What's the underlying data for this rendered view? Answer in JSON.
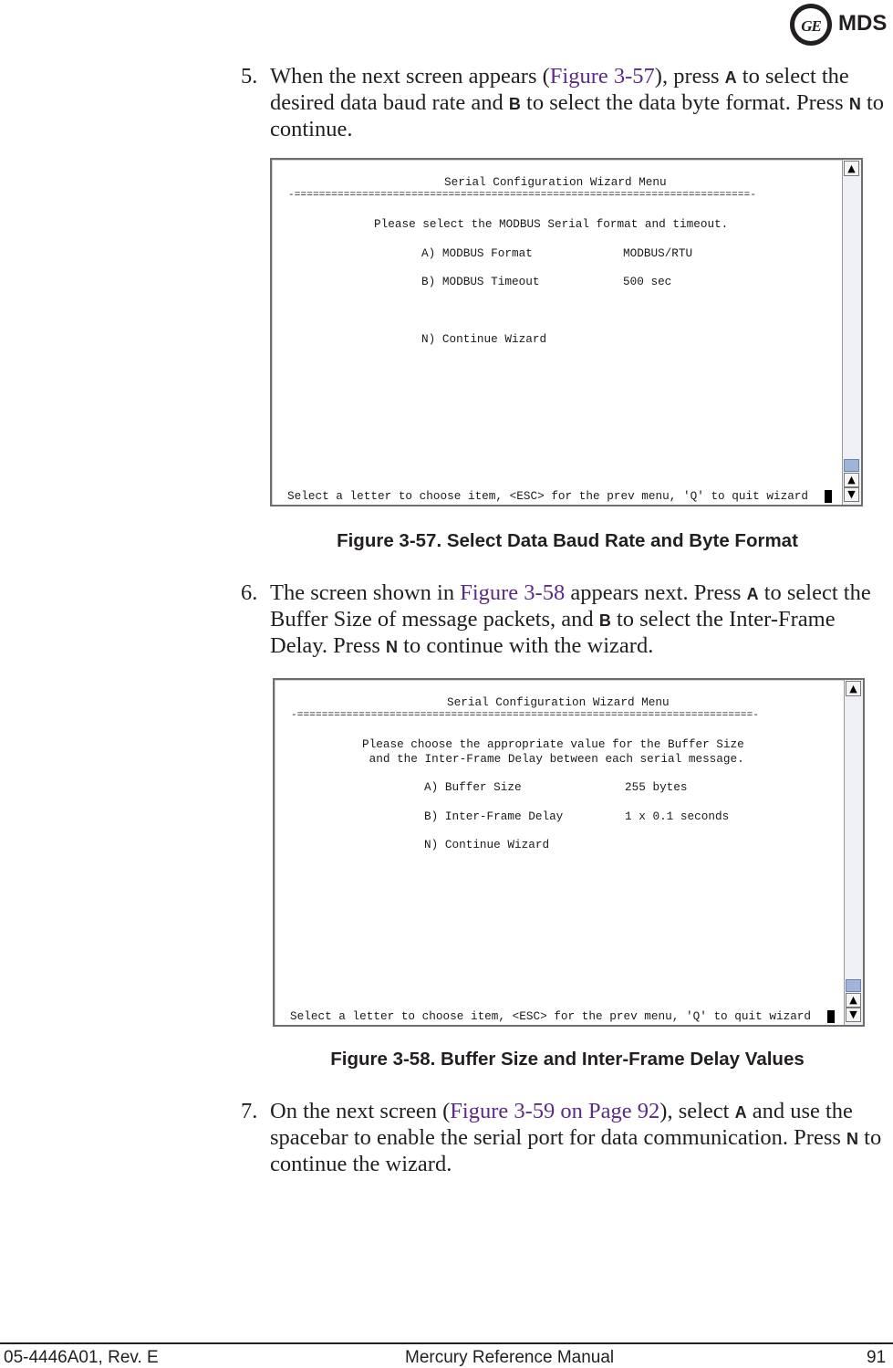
{
  "header": {
    "logo_mark": "GE",
    "logo_text": "MDS"
  },
  "steps": [
    {
      "number": "5.",
      "parts": {
        "t1": "When the next screen appears (",
        "link": "Figure 3-57",
        "t2": "), press ",
        "k1": "A",
        "t3": " to select the desired data baud rate and ",
        "k2": "B",
        "t4": " to select the data byte format. Press ",
        "k3": "N",
        "t5": " to continue."
      }
    },
    {
      "number": "6.",
      "parts": {
        "t1": "The screen shown in ",
        "link": "Figure 3-58",
        "t2": " appears next. Press ",
        "k1": "A",
        "t3": " to select the Buffer Size of message packets, and ",
        "k2": "B",
        "t4": " to select the Inter-Frame Delay. Press ",
        "k3": "N",
        "t5": " to continue with the wizard."
      }
    },
    {
      "number": "7.",
      "parts": {
        "t1": "On the next screen (",
        "link": "Figure 3-59 on Page 92",
        "t2": "), select ",
        "k1": "A",
        "t3": " and use the spacebar to enable the serial port for data communication. Press ",
        "k2": "N",
        "t4": " to continue the wizard."
      }
    }
  ],
  "figures": [
    {
      "caption": "Figure 3-57. Select Data Baud Rate and Byte Format",
      "terminal": {
        "title": "Serial Configuration Wizard Menu",
        "separator": "-==========================================================================-",
        "prompt_lines": [
          "Please select the MODBUS Serial format and timeout."
        ],
        "items": [
          {
            "key": "A)",
            "label": "MODBUS Format",
            "value": "MODBUS/RTU"
          },
          {
            "key": "B)",
            "label": "MODBUS Timeout",
            "value": "500 sec"
          },
          {
            "key": "N)",
            "label": "Continue Wizard",
            "value": ""
          }
        ],
        "status": "Select a letter to choose item, <ESC> for the prev menu, 'Q' to quit wizard"
      }
    },
    {
      "caption": "Figure 3-58. Buffer Size and Inter-Frame Delay Values",
      "terminal": {
        "title": "Serial Configuration Wizard Menu",
        "separator": "-==========================================================================-",
        "prompt_lines": [
          "Please choose the appropriate value for the Buffer Size",
          " and the Inter-Frame Delay between each serial message."
        ],
        "items": [
          {
            "key": "A)",
            "label": "Buffer Size",
            "value": "255 bytes"
          },
          {
            "key": "B)",
            "label": "Inter-Frame Delay",
            "value": "1 x 0.1 seconds"
          },
          {
            "key": "N)",
            "label": "Continue Wizard",
            "value": ""
          }
        ],
        "status": "Select a letter to choose item, <ESC> for the prev menu, 'Q' to quit wizard"
      }
    }
  ],
  "scroll_icons": {
    "up": "▲",
    "down": "▼"
  },
  "footer": {
    "doc_number": "05-4446A01, Rev. E",
    "title": "Mercury Reference Manual",
    "page": "91"
  }
}
